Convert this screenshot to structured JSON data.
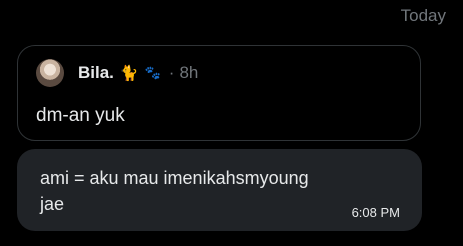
{
  "date_divider": "Today",
  "quoted_post": {
    "display_name": "Bila.",
    "emojis": {
      "cat": "🐈",
      "paw": "🐾"
    },
    "separator": "·",
    "time": "8h",
    "text": "dm-an yuk"
  },
  "message": {
    "text": "ami = aku mau imenikahsmyoungjae",
    "time": "6:08 PM"
  },
  "colors": {
    "background": "#000000",
    "bubble": "#202327",
    "border": "#2f3336",
    "muted_text": "#71767b",
    "primary_text": "#e7e9ea"
  }
}
